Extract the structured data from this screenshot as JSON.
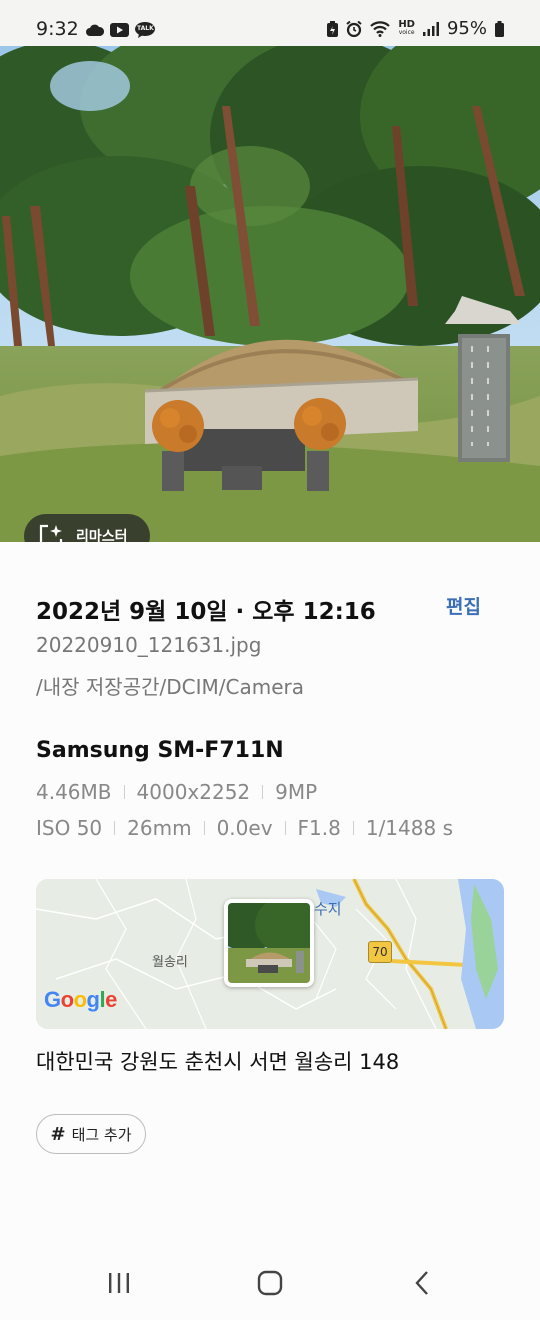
{
  "status_bar": {
    "time": "9:32",
    "left_icons": [
      "cloud-icon",
      "youtube-icon",
      "kakaotalk-icon"
    ],
    "kakao_label": "TALK",
    "right_icons": [
      "battery-saver-icon",
      "alarm-icon",
      "wifi-icon",
      "hd-voice-icon",
      "signal-icon"
    ],
    "hd_label": "HD",
    "voice_label": "voice",
    "battery": "95%"
  },
  "photo": {
    "remaster_label": "리마스터"
  },
  "details": {
    "datetime": "2022년 9월 10일 · 오후 12:16",
    "edit_label": "편집",
    "filename": "20220910_121631.jpg",
    "path": "/내장 저장공간/DCIM/Camera",
    "model": "Samsung SM-F711N",
    "specs_row1": [
      "4.46MB",
      "4000x2252",
      "9MP"
    ],
    "specs_row2": [
      "ISO 50",
      "26mm",
      "0.0ev",
      "F1.8",
      "1/1488 s"
    ]
  },
  "map": {
    "village_label": "월송리",
    "reservoir_label": "수지",
    "route_number": "70",
    "google_letters": [
      "G",
      "o",
      "o",
      "g",
      "l",
      "e"
    ],
    "colors": {
      "land": "#e7ece4",
      "water": "#a9c8f3",
      "road": "#f3c641",
      "google_blue": "#4285f4",
      "google_red": "#ea4335",
      "google_yellow": "#fbbc05",
      "google_green": "#34a853"
    }
  },
  "address": "대한민국 강원도 춘천시 서면 월송리 148",
  "tag_button": {
    "hash": "#",
    "label": "태그 추가"
  },
  "nav": {
    "icons": [
      "recent-apps-icon",
      "home-icon",
      "back-icon"
    ]
  },
  "colors": {
    "accent": "#3a6fb8",
    "secondary_text": "#777777"
  }
}
